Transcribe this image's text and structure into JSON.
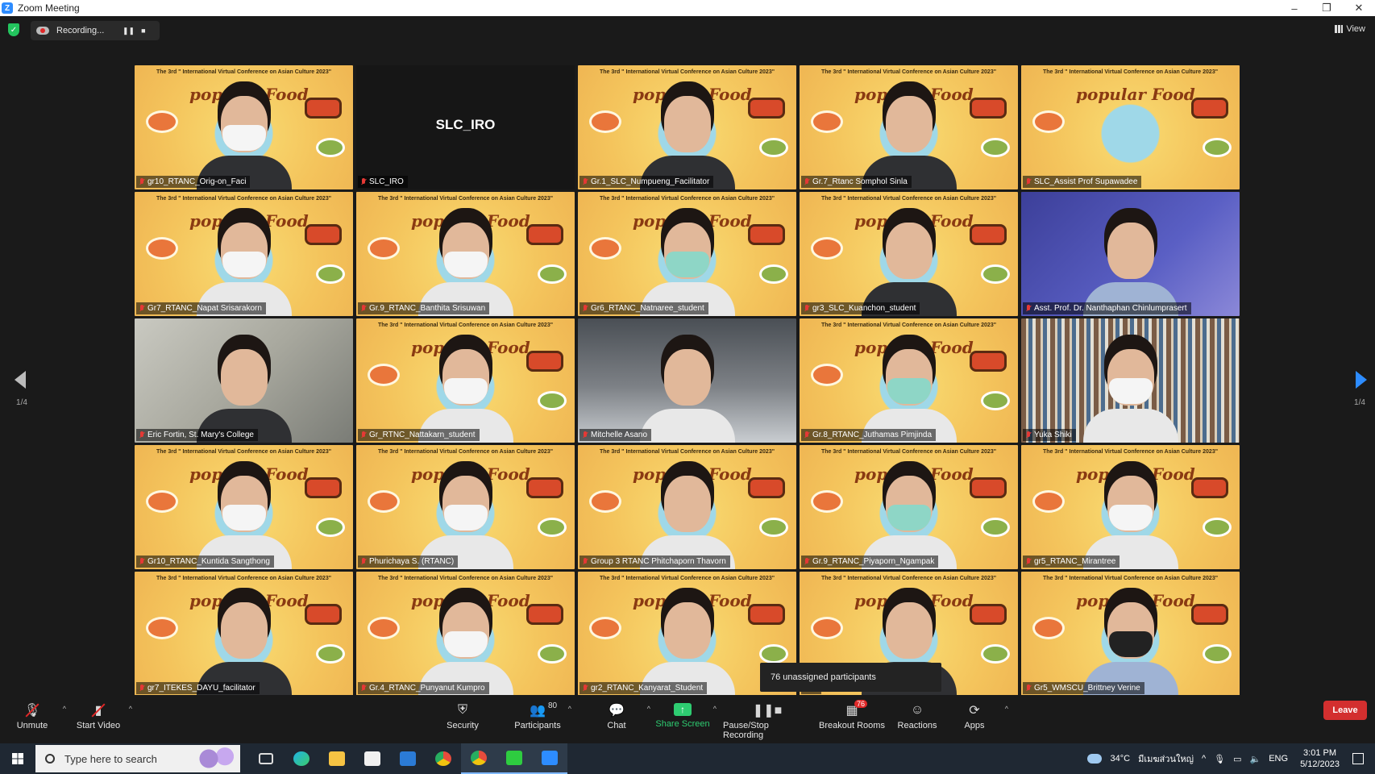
{
  "window": {
    "app_icon": "Z",
    "title": "Zoom Meeting",
    "controls": [
      "–",
      "❐",
      "✕"
    ]
  },
  "recording": {
    "label": "Recording...",
    "pause_icon": "❚❚",
    "stop_icon": "■"
  },
  "view_label": "View",
  "meeting_banner": "The 3rd \" International Virtual Conference on Asian Culture 2023\"",
  "background_title": "popular Food",
  "slc_label": "SLC_IRO",
  "participants": [
    {
      "name": "gr10_RTANC_Orig-on_Faci",
      "bg": "food",
      "mask": "white",
      "body": "dark"
    },
    {
      "name": "SLC_IRO",
      "bg": "black",
      "mask": "none",
      "body": "none"
    },
    {
      "name": "Gr.1_SLC_Numpueng_Facilitator",
      "bg": "food",
      "mask": "none",
      "body": "dark"
    },
    {
      "name": "Gr.7_Rtanc Somphol Sinla",
      "bg": "food",
      "mask": "none",
      "body": "dark"
    },
    {
      "name": "SLC_Assist Prof Supawadee",
      "bg": "food",
      "mask": "none",
      "body": "none"
    },
    {
      "name": "Gr7_RTANC_Napat Srisarakorn",
      "bg": "food",
      "mask": "white",
      "body": "white"
    },
    {
      "name": "Gr.9_RTANC_Banthita Srisuwan",
      "bg": "food",
      "mask": "white",
      "body": "white"
    },
    {
      "name": "Gr6_RTANC_Natnaree_student",
      "bg": "food",
      "mask": "green",
      "body": "white"
    },
    {
      "name": "gr3_SLC_Kuanchon_student",
      "bg": "food",
      "mask": "none",
      "body": "dark"
    },
    {
      "name": "Asst. Prof. Dr. Nanthaphan Chinlumprasert",
      "bg": "purple",
      "mask": "none",
      "body": "blue"
    },
    {
      "name": "Eric Fortin, St. Mary's College",
      "bg": "office",
      "mask": "none",
      "body": "dark"
    },
    {
      "name": "Gr_RTNC_Nattakarn_student",
      "bg": "food",
      "mask": "white",
      "body": "white"
    },
    {
      "name": "Mitchelle Asano",
      "bg": "room",
      "mask": "none",
      "body": "white"
    },
    {
      "name": "Gr.8_RTANC_Juthamas Pimjinda",
      "bg": "food",
      "mask": "green",
      "body": "white"
    },
    {
      "name": "Yuka Shiki",
      "bg": "books",
      "mask": "white",
      "body": "white"
    },
    {
      "name": "Gr10_RTANC_Kuntida Sangthong",
      "bg": "food",
      "mask": "white",
      "body": "white"
    },
    {
      "name": "Phurichaya S. (RTANC)",
      "bg": "food",
      "mask": "white",
      "body": "white"
    },
    {
      "name": "Group 3 RTANC Phitchaporn Thavorn",
      "bg": "food",
      "mask": "none",
      "body": "white"
    },
    {
      "name": "Gr.9_RTANC_Piyaporn_Ngampak",
      "bg": "food",
      "mask": "green",
      "body": "white"
    },
    {
      "name": "gr5_RTANC_Mirantree",
      "bg": "food",
      "mask": "white",
      "body": "white"
    },
    {
      "name": "gr7_ITEKES_DAYU_facilitator",
      "bg": "food",
      "mask": "none",
      "body": "dark"
    },
    {
      "name": "Gr.4_RTANC_Punyanut Kumpro",
      "bg": "food",
      "mask": "white",
      "body": "white"
    },
    {
      "name": "gr2_RTANC_Kanyarat_Student",
      "bg": "food",
      "mask": "none",
      "body": "white"
    },
    {
      "name": "n",
      "bg": "food",
      "mask": "none",
      "body": "dark"
    },
    {
      "name": "Gr5_WMSCU_Brittney Verine",
      "bg": "food",
      "mask": "black",
      "body": "blue"
    }
  ],
  "pagination": {
    "left": "1/4",
    "right": "1/4"
  },
  "unassigned": "76 unassigned participants",
  "toolbar": {
    "unmute": "Unmute",
    "start_video": "Start Video",
    "security": "Security",
    "participants": "Participants",
    "participants_count": "80",
    "chat": "Chat",
    "share_screen": "Share Screen",
    "pause_stop_recording": "Pause/Stop Recording",
    "breakout_rooms": "Breakout Rooms",
    "breakout_count": "76",
    "reactions": "Reactions",
    "apps": "Apps",
    "leave": "Leave"
  },
  "taskbar": {
    "search_placeholder": "Type here to search",
    "temperature": "34°C",
    "weather_text": "มีเมฆส่วนใหญ่",
    "language": "ENG",
    "time": "3:01 PM",
    "date": "5/12/2023"
  },
  "colors": {
    "accent": "#2d8cff",
    "share_green": "#2ecc71",
    "leave_red": "#d32f2f",
    "mic_off_red": "#e53935"
  }
}
